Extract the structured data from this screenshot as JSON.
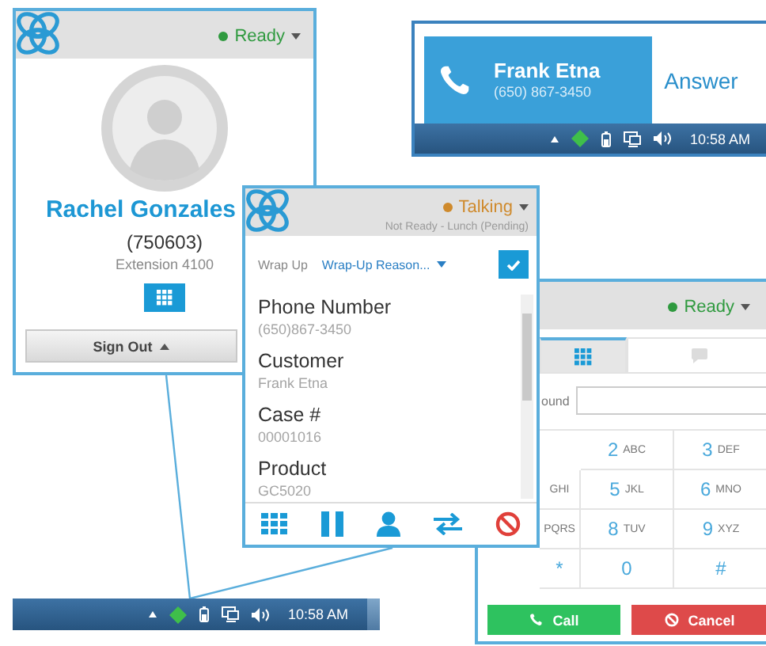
{
  "agent_window": {
    "status": {
      "label": "Ready",
      "kind": "ready"
    },
    "name": "Rachel Gonzales",
    "agent_id": "(750603)",
    "extension": "Extension 4100",
    "sign_out": "Sign Out"
  },
  "incoming_call": {
    "caller": "Frank Etna",
    "number": "(650) 867-3450",
    "action": "Answer",
    "time": "10:58 AM"
  },
  "call_window": {
    "status": {
      "label": "Talking",
      "kind": "talking"
    },
    "substatus": "Not Ready - Lunch (Pending)",
    "wrap_up": "Wrap Up",
    "wrap_up_reason": "Wrap-Up Reason...",
    "fields": [
      {
        "label": "Phone Number",
        "value": "(650)867-3450"
      },
      {
        "label": "Customer",
        "value": "Frank Etna"
      },
      {
        "label": "Case #",
        "value": "00001016"
      },
      {
        "label": "Product",
        "value": "GC5020"
      }
    ]
  },
  "dialer_window": {
    "status": {
      "label": "Ready",
      "kind": "ready"
    },
    "tabs": [
      {
        "selected": true
      },
      {
        "selected": false
      }
    ],
    "number_label": "ound",
    "keys": [
      {
        "digit": "2",
        "letters": "ABC"
      },
      {
        "digit": "3",
        "letters": "DEF"
      },
      {
        "letters": "GHI"
      },
      {
        "digit": "5",
        "letters": "JKL"
      },
      {
        "digit": "6",
        "letters": "MNO"
      },
      {
        "letters": "PQRS"
      },
      {
        "digit": "8",
        "letters": "TUV"
      },
      {
        "digit": "9",
        "letters": "XYZ"
      },
      {
        "digit": "*"
      },
      {
        "digit": "0"
      },
      {
        "digit": "#"
      }
    ],
    "call": "Call",
    "cancel": "Cancel"
  },
  "taskbar": {
    "time": "10:58 AM"
  }
}
